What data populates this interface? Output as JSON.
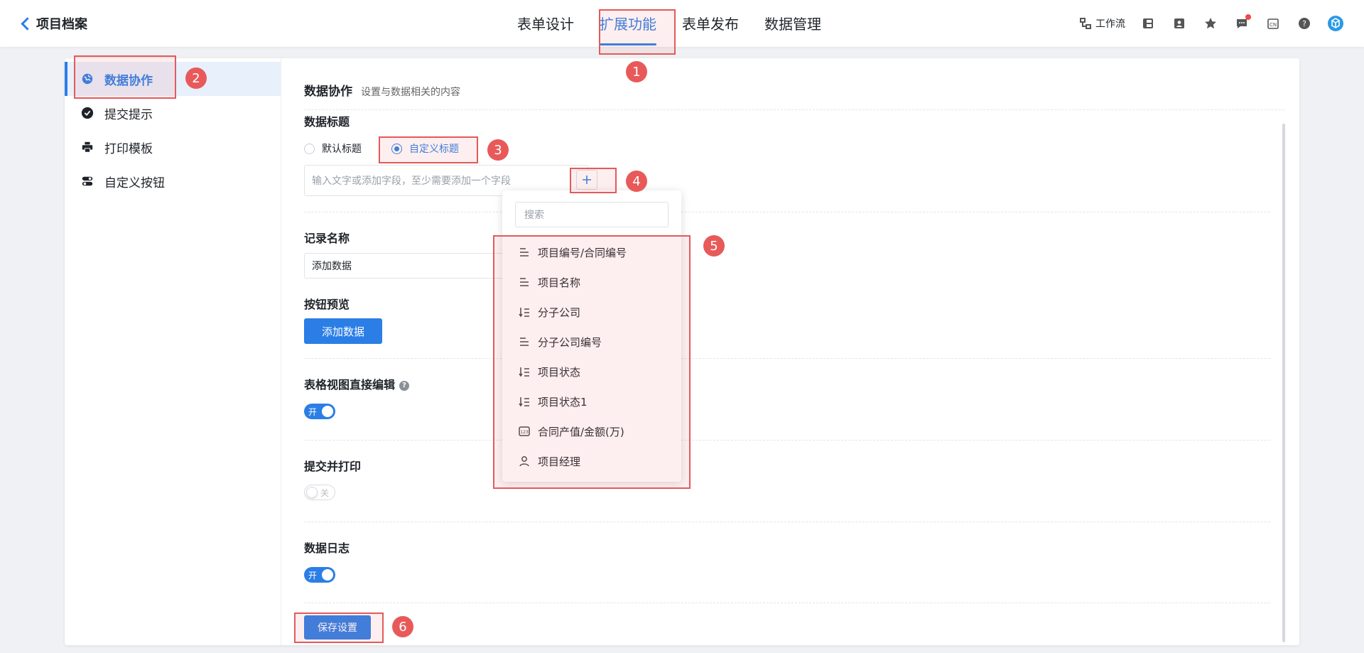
{
  "header": {
    "back_title": "项目档案",
    "tabs": [
      {
        "label": "表单设计",
        "active": false
      },
      {
        "label": "扩展功能",
        "active": true
      },
      {
        "label": "表单发布",
        "active": false
      },
      {
        "label": "数据管理",
        "active": false
      }
    ],
    "workflow_label": "工作流",
    "lang_label": "CN",
    "accent_color": "#2b7ee6"
  },
  "sidebar": {
    "items": [
      {
        "label": "数据协作",
        "icon": "globe-icon",
        "active": true
      },
      {
        "label": "提交提示",
        "icon": "check-circle-icon",
        "active": false
      },
      {
        "label": "打印模板",
        "icon": "printer-icon",
        "active": false
      },
      {
        "label": "自定义按钮",
        "icon": "toggle-icon",
        "active": false
      }
    ]
  },
  "content": {
    "title": "数据协作",
    "subtitle": "设置与数据相关的内容",
    "data_title": {
      "label": "数据标题",
      "option_default": "默认标题",
      "option_custom": "自定义标题",
      "selected": "自定义标题",
      "input_placeholder": "输入文字或添加字段，至少需要添加一个字段"
    },
    "record_name": {
      "label": "记录名称",
      "value": "添加数据"
    },
    "button_preview": {
      "label": "按钮预览",
      "button_label": "添加数据"
    },
    "table_edit": {
      "label": "表格视图直接编辑",
      "help": "?",
      "toggle_text": "开",
      "on": true
    },
    "submit_print": {
      "label": "提交并打印",
      "toggle_text": "关",
      "on": false
    },
    "data_log": {
      "label": "数据日志",
      "toggle_text": "开",
      "on": true
    },
    "save_button": "保存设置"
  },
  "dropdown": {
    "search_placeholder": "搜索",
    "items": [
      {
        "label": "项目编号/合同编号",
        "icon": "text-lines-icon"
      },
      {
        "label": "项目名称",
        "icon": "text-lines-icon"
      },
      {
        "label": "分子公司",
        "icon": "sort-list-icon"
      },
      {
        "label": "分子公司编号",
        "icon": "text-lines-icon"
      },
      {
        "label": "项目状态",
        "icon": "sort-list-icon"
      },
      {
        "label": "项目状态1",
        "icon": "sort-list-icon"
      },
      {
        "label": "合同产值/金额(万)",
        "icon": "number-icon"
      },
      {
        "label": "项目经理",
        "icon": "user-icon"
      }
    ]
  },
  "annotations": [
    "1",
    "2",
    "3",
    "4",
    "5",
    "6"
  ],
  "annotation_color": "#e85a5a"
}
